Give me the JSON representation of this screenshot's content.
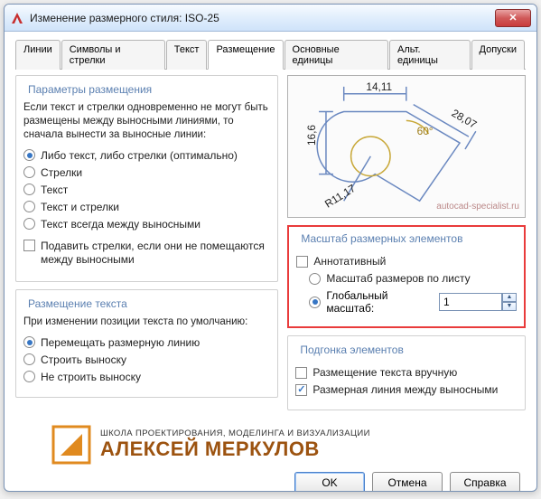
{
  "window": {
    "title": "Изменение размерного стиля: ISO-25"
  },
  "tabs": [
    "Линии",
    "Символы и стрелки",
    "Текст",
    "Размещение",
    "Основные единицы",
    "Альт. единицы",
    "Допуски"
  ],
  "fit": {
    "legend": "Параметры размещения",
    "intro": "Если текст и стрелки одновременно не могут быть размещены между выносными линиями, то сначала вынести за выносные линии:",
    "opts": [
      "Либо текст, либо стрелки (оптимально)",
      "Стрелки",
      "Текст",
      "Текст и стрелки",
      "Текст всегда между выносными"
    ],
    "suppress": "Подавить стрелки, если они не помещаются между выносными"
  },
  "textplace": {
    "legend": "Размещение текста",
    "intro": "При изменении позиции текста по умолчанию:",
    "opts": [
      "Перемещать размерную линию",
      "Строить выноску",
      "Не строить выноску"
    ]
  },
  "preview": {
    "dims": {
      "top": "14,11",
      "left": "16,6",
      "diag": "28,07",
      "ang": "60°",
      "rad": "R11,17"
    },
    "watermark": "autocad-specialist.ru"
  },
  "scale": {
    "legend": "Масштаб размерных элементов",
    "annotative": "Аннотативный",
    "layout": "Масштаб размеров по листу",
    "global": "Глобальный масштаб:",
    "value": "1"
  },
  "fine": {
    "legend": "Подгонка элементов",
    "manual": "Размещение текста вручную",
    "between": "Размерная линия между выносными"
  },
  "logo": {
    "small": "ШКОЛА  ПРОЕКТИРОВАНИЯ, МОДЕЛИНГА И ВИЗУАЛИЗАЦИИ",
    "big": "АЛЕКСЕЙ МЕРКУЛОВ"
  },
  "buttons": {
    "ok": "OK",
    "cancel": "Отмена",
    "help": "Справка"
  }
}
